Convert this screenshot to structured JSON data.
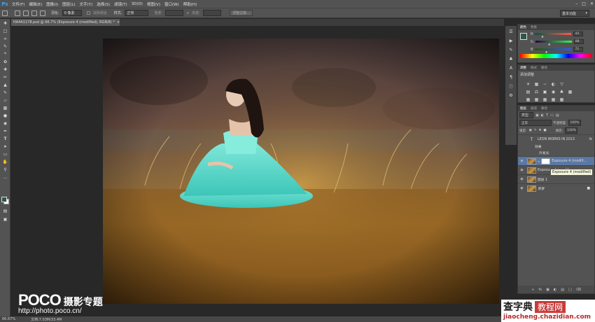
{
  "menubar": {
    "logo": "Ps",
    "items": [
      "文件(F)",
      "编辑(E)",
      "图像(I)",
      "图层(L)",
      "文字(Y)",
      "选择(S)",
      "滤镜(T)",
      "3D(D)",
      "视图(V)",
      "窗口(W)",
      "帮助(H)"
    ]
  },
  "options": {
    "feather_label": "羽化:",
    "feather_value": "0 像素",
    "antialias_label": "消除锯齿",
    "style_label": "样式:",
    "style_value": "正常",
    "width_label": "宽度:",
    "height_label": "高度:",
    "refine_button": "调整边缘...",
    "workspace": "基本功能"
  },
  "document": {
    "tab_title": "HA4A1178.psd @ 66.7% (Exposure 4 (modified), RGB/8) *"
  },
  "status": {
    "zoom": "66.67%",
    "doc_info": "文档:7.03M/33.4M"
  },
  "color_panel": {
    "tabs": [
      "颜色",
      "色板"
    ],
    "r_label": "R",
    "r_value": "44",
    "g_label": "G",
    "g_value": "88",
    "b_label": "B",
    "b_value": "72",
    "fg_color": "#2c5848",
    "r_pos": 0.17,
    "g_pos": 0.35,
    "b_pos": 0.28
  },
  "adjust_panel": {
    "tabs": [
      "调整",
      "样式",
      "路径"
    ],
    "title": "添加调整"
  },
  "layers_panel": {
    "tabs": [
      "图层",
      "通道",
      "路径"
    ],
    "filter": "类型",
    "blend_mode": "正常",
    "opacity_label": "不透明度:",
    "opacity": "100%",
    "lock_label": "锁定:",
    "fill_label": "填充:",
    "fill": "100%",
    "layers": [
      {
        "name": "LEON WORKS IN 2013",
        "type": "text",
        "fx": "fx",
        "visible": false
      },
      {
        "name": "效果",
        "type": "effect"
      },
      {
        "name": "外发光",
        "type": "effect-item"
      },
      {
        "name": "Exposure 4 (modifi...",
        "type": "image-mask",
        "selected": true,
        "visible": true
      },
      {
        "name": "Exposure 4 (modifi...",
        "type": "image",
        "visible": true
      },
      {
        "name": "图层 1",
        "type": "image",
        "visible": true
      },
      {
        "name": "背景",
        "type": "background",
        "visible": true
      }
    ],
    "tooltip": "Exposure 4 (modified)"
  },
  "watermarks": {
    "poco_brand": "POCO",
    "poco_title": "摄影专题",
    "poco_url": "http://photo.poco.cn/",
    "site_title": "查字典",
    "site_sub": "教程网",
    "site_url": "jiaocheng.chazidian.com"
  }
}
